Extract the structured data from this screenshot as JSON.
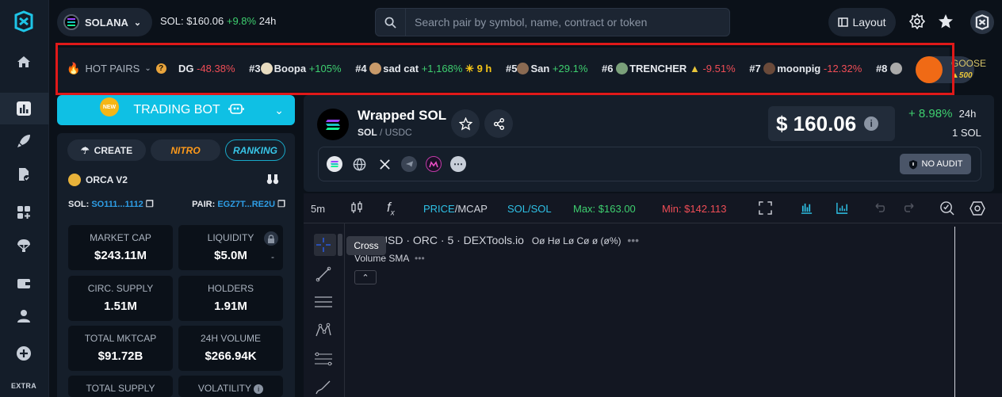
{
  "topbar": {
    "chain": "SOLANA",
    "sol_price_label": "SOL: $160.06",
    "sol_change": "+9.8%",
    "sol_period": "24h",
    "search_placeholder": "Search pair by symbol, name, contract or token",
    "layout_label": "Layout"
  },
  "rail": {
    "extra_label": "EXTRA"
  },
  "hot_pairs": {
    "label": "HOT PAIRS",
    "items": [
      {
        "rank": "",
        "name": "DG",
        "change": "-48.38%",
        "dir": "down"
      },
      {
        "rank": "#3",
        "name": "Boopa",
        "change": "+105%",
        "dir": "up"
      },
      {
        "rank": "#4",
        "name": "sad cat",
        "change": "+1,168%",
        "extra": "9 h",
        "dir": "up"
      },
      {
        "rank": "#5",
        "name": "San",
        "change": "+29.1%",
        "dir": "up"
      },
      {
        "rank": "#6",
        "name": "TRENCHER",
        "change": "-9.51%",
        "dir": "down"
      },
      {
        "rank": "#7",
        "name": "moonpig",
        "change": "-12.32%",
        "dir": "down"
      },
      {
        "rank": "#8",
        "name": "",
        "change": "",
        "dir": "up"
      }
    ],
    "goose_name": "GOOSE",
    "goose_value": "500"
  },
  "left_panel": {
    "trading_bot_label": "TRADING BOT",
    "new_badge": "NEW",
    "tabs": {
      "create": "CREATE",
      "nitro": "NITRO",
      "ranking": "RANKING"
    },
    "dex": "ORCA V2",
    "sol_label": "SOL:",
    "sol_addr": "SO111...1112",
    "pair_label": "PAIR:",
    "pair_addr": "EGZ7T...RE2U",
    "stats": [
      {
        "title": "MARKET CAP",
        "value": "$243.11M"
      },
      {
        "title": "LIQUIDITY",
        "value": "$5.0M"
      },
      {
        "title": "CIRC. SUPPLY",
        "value": "1.51M"
      },
      {
        "title": "HOLDERS",
        "value": "1.91M"
      },
      {
        "title": "TOTAL MKTCAP",
        "value": "$91.72B"
      },
      {
        "title": "24H VOLUME",
        "value": "$266.94K"
      },
      {
        "title": "TOTAL SUPPLY",
        "value": ""
      },
      {
        "title": "VOLATILITY",
        "value": ""
      }
    ]
  },
  "token": {
    "name": "Wrapped SOL",
    "base": "SOL",
    "quote": "/ USDC",
    "price": "$ 160.06",
    "change": "+ 8.98%",
    "change_period": "24h",
    "unit": "1 SOL",
    "audit": "NO AUDIT"
  },
  "chart": {
    "timeframe": "5m",
    "price_mcap_a": "PRICE",
    "price_mcap_b": "/MCAP",
    "pair_toggle": "SOL/SOL",
    "max": "Max: $163.00",
    "min": "Min: $142.113",
    "legend": "SOL/USD · ORC · 5 · DEXTools.io",
    "ohlc": "Oø Hø Lø Cø ø (ø%)",
    "volume": "Volume SMA",
    "tooltip": "Cross"
  },
  "colors": {
    "accent": "#0fc0e4",
    "up": "#3ecf6f",
    "down": "#ef4d56",
    "highlight": "#e01919"
  }
}
